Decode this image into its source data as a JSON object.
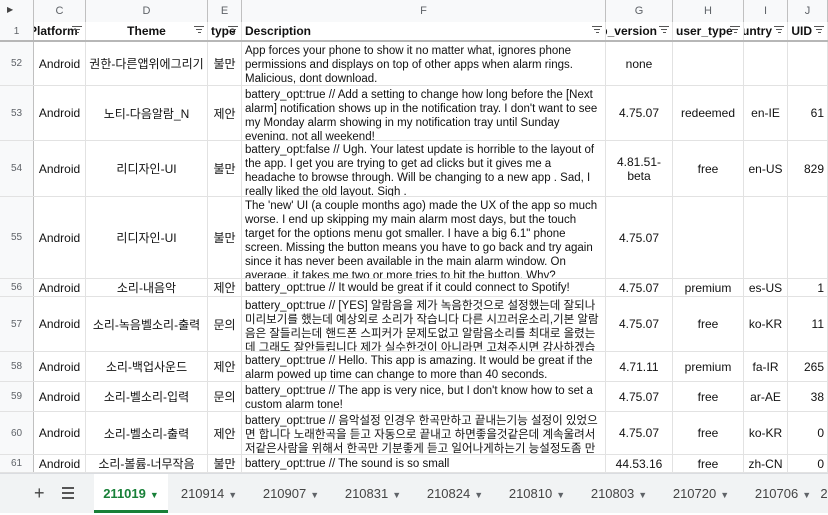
{
  "columns": [
    {
      "letter": "C",
      "header": "Platform"
    },
    {
      "letter": "D",
      "header": "Theme"
    },
    {
      "letter": "E",
      "header": "type"
    },
    {
      "letter": "F",
      "header": "Description"
    },
    {
      "letter": "G",
      "header": "app_version"
    },
    {
      "letter": "H",
      "header": "user_type"
    },
    {
      "letter": "I",
      "header": "user_country"
    },
    {
      "letter": "J",
      "header": "UID"
    }
  ],
  "header_row_number": "1",
  "rows": [
    {
      "num": "52",
      "platform": "Android",
      "theme": "권한-다른앱위에그리기",
      "type": "불만",
      "desc": "App forces your phone to show it no matter what, ignores phone permissions and displays on top of other apps when alarm rings. Malicious, dont download.",
      "version": "none",
      "user_type": "",
      "country": "",
      "uid": ""
    },
    {
      "num": "53",
      "platform": "Android",
      "theme": "노티-다음알람_N",
      "type": "제안",
      "desc": "battery_opt:true // Add a setting to change how long before the [Next alarm] notification shows up in the notification tray. I don't want to see my Monday alarm showing in my notification tray until Sunday evening, not all weekend!",
      "version": "4.75.07",
      "user_type": "redeemed",
      "country": "en-IE",
      "uid": "61"
    },
    {
      "num": "54",
      "platform": "Android",
      "theme": "리디자인-UI",
      "type": "불만",
      "desc": "battery_opt:false //  Ugh. Your latest update is horrible to the layout of the app. I get you are trying to get ad clicks but it gives me a headache to browse through. Will be changing to a new app . Sad, I really liked the old layout. Sigh .",
      "version": "4.81.51-beta",
      "user_type": "free",
      "country": "en-US",
      "uid": "829"
    },
    {
      "num": "55",
      "platform": "Android",
      "theme": "리디자인-UI",
      "type": "불만",
      "desc": "The 'new' UI (a couple months ago) made the UX of the app so much worse. I end up skipping my main alarm most days, but the touch target for the options menu got smaller. I have a big 6.1\" phone screen. Missing the button means you have to go back and try again since it has never been available in the main alarm window. On average, it takes me two or more tries to hit the button. Why?",
      "version": "4.75.07",
      "user_type": "",
      "country": "",
      "uid": ""
    },
    {
      "num": "56",
      "platform": "Android",
      "theme": "소리-내음악",
      "type": "제안",
      "desc": "battery_opt:true // It would be great if it could connect to Spotify!",
      "version": "4.75.07",
      "user_type": "premium",
      "country": "es-US",
      "uid": "1"
    },
    {
      "num": "57",
      "platform": "Android",
      "theme": "소리-녹음벨소리-출력",
      "type": "문의",
      "desc": "battery_opt:true // [YES] 알람음을 제가 녹음한것으로 설정했는데 잘되나 미리보기를 했는데 예상외로 소리가 작습니다 다른 시끄러운소리,기본 알람음은 잘들리는데 핸드폰 스피커가 문제도없고 알람음소리를 최대로 올렸는데 그래도 잘안들립니다 제가 실수한것이 아니라면 고쳐주시면 감사하겠습니다.",
      "version": "4.75.07",
      "user_type": "free",
      "country": "ko-KR",
      "uid": "11"
    },
    {
      "num": "58",
      "platform": "Android",
      "theme": "소리-백업사운드",
      "type": "제안",
      "desc": "battery_opt:true // Hello. This app is amazing. It would be great if the alarm powed up time can change to more than 40 seconds.",
      "version": "4.71.11",
      "user_type": "premium",
      "country": "fa-IR",
      "uid": "265"
    },
    {
      "num": "59",
      "platform": "Android",
      "theme": "소리-벨소리-입력",
      "type": "문의",
      "desc": "battery_opt:true // The app is very nice, but I don't know how to set a custom alarm tone!",
      "version": "4.75.07",
      "user_type": "free",
      "country": "ar-AE",
      "uid": "38"
    },
    {
      "num": "60",
      "platform": "Android",
      "theme": "소리-벨소리-출력",
      "type": "제안",
      "desc": "battery_opt:true // 음악설정 인경우 한곡만하고 끝내는기능  설정이 있었으면 합니다 노래한곡을 듣고 자동으로 끝내고 하면좋을것같은데 계속울려서 저같은사람을 위해서  한곡만 기분좋게 듣고 일어나게하는기 능설정도좀 만들어 주셨으면 합니다",
      "version": "4.75.07",
      "user_type": "free",
      "country": "ko-KR",
      "uid": "0"
    },
    {
      "num": "61",
      "platform": "Android",
      "theme": "소리-볼륨-너무작음",
      "type": "불만",
      "desc": "battery_opt:true // The sound is so small",
      "version": "44.53.16",
      "user_type": "free",
      "country": "zh-CN",
      "uid": "0"
    }
  ],
  "tabs": {
    "active": "211019",
    "others": [
      "210914",
      "210907",
      "210831",
      "210824",
      "210810",
      "210803",
      "210720",
      "210706",
      "2"
    ]
  },
  "icons": {
    "add": "plus-icon",
    "all_sheets": "sheet-list-icon",
    "filter": "filter-icon",
    "dropdown": "caret-down-icon"
  },
  "colors": {
    "accent": "#188038",
    "header_bg": "#f8f9fa",
    "grid": "#e2e2e2"
  }
}
